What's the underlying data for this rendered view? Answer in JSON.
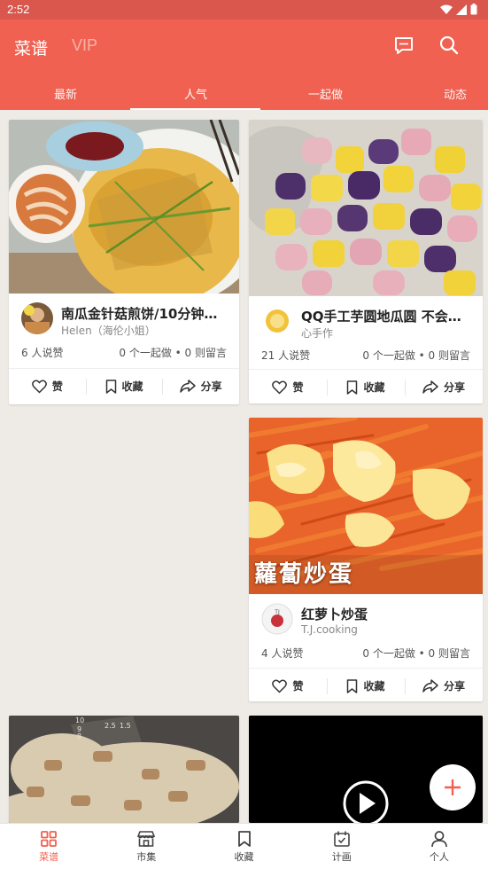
{
  "status_bar": {
    "time": "2:52"
  },
  "header": {
    "brand": "菜谱",
    "vip": "VIP",
    "tabs": [
      {
        "label": "最新"
      },
      {
        "label": "人气"
      },
      {
        "label": "一起做"
      },
      {
        "label": "动态"
      }
    ],
    "active_tab": "人气"
  },
  "cards": [
    {
      "title": "南瓜金针菇煎饼/10分钟…",
      "author": "Helen（海伦小姐）",
      "likes": "6 人说赞",
      "stats": "0 个一起做 • 0 则留言"
    },
    {
      "title": "QQ手工芋圆地瓜圆 不会…",
      "author": "心手作",
      "likes": "21 人说赞",
      "stats": "0 个一起做 • 0 则留言"
    },
    {
      "title": "红萝卜炒蛋",
      "author": "T.J.cooking",
      "likes": "4 人说赞",
      "stats": "0 个一起做 • 0 则留言",
      "photo_overlay_text": "蘿蔔炒蛋"
    }
  ],
  "card_actions": {
    "like": "赞",
    "collect": "收藏",
    "share": "分享"
  },
  "bottom_nav": [
    {
      "label": "菜谱",
      "icon": "grid-icon"
    },
    {
      "label": "市集",
      "icon": "store-icon"
    },
    {
      "label": "收藏",
      "icon": "bookmark-icon"
    },
    {
      "label": "计画",
      "icon": "calendar-icon"
    },
    {
      "label": "个人",
      "icon": "person-icon"
    }
  ],
  "colors": {
    "primary": "#f06151",
    "status_bar": "#d9574c",
    "background": "#eeebe6"
  }
}
